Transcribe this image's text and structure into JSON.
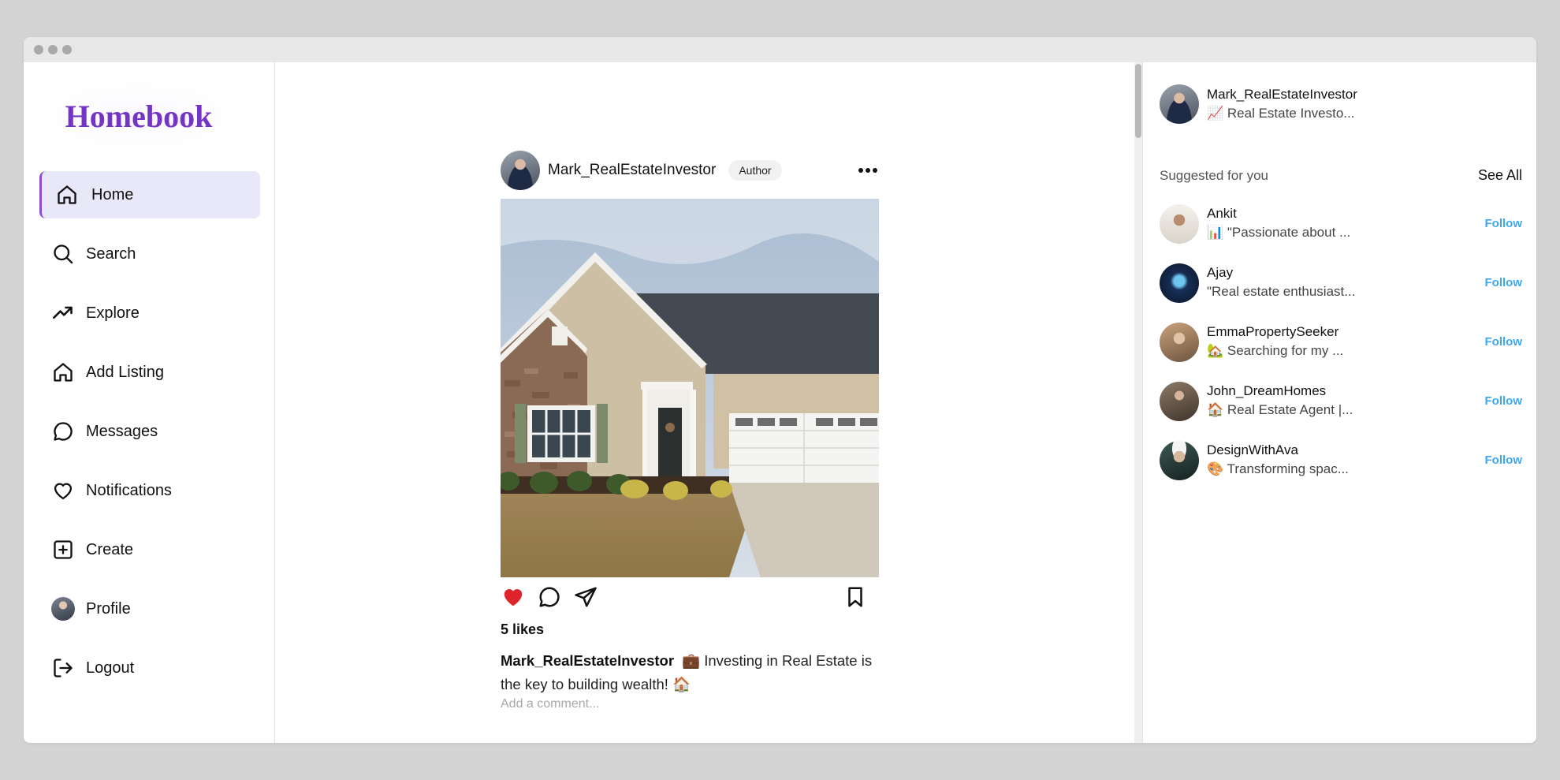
{
  "app": {
    "title": "Homebook"
  },
  "nav": [
    {
      "label": "Home",
      "icon": "home-icon",
      "active": true
    },
    {
      "label": "Search",
      "icon": "search-icon"
    },
    {
      "label": "Explore",
      "icon": "trending-icon"
    },
    {
      "label": "Add Listing",
      "icon": "house-plus-icon"
    },
    {
      "label": "Messages",
      "icon": "message-icon"
    },
    {
      "label": "Notifications",
      "icon": "heart-icon"
    },
    {
      "label": "Create",
      "icon": "plus-square-icon"
    },
    {
      "label": "Profile",
      "icon": "avatar"
    },
    {
      "label": "Logout",
      "icon": "logout-icon"
    }
  ],
  "post": {
    "username": "Mark_RealEstateInvestor",
    "badge": "Author",
    "likes": "5 likes",
    "caption_user": "Mark_RealEstateInvestor",
    "caption_text": "💼 Investing in Real Estate is the key to building wealth! 🏠",
    "comment_placeholder": "Add a comment..."
  },
  "current_user": {
    "name": "Mark_RealEstateInvestor",
    "bio": "📈 Real Estate Investo..."
  },
  "suggestions": {
    "title": "Suggested for you",
    "see_all": "See All",
    "follow_label": "Follow",
    "users": [
      {
        "name": "Ankit",
        "bio": "📊 \"Passionate about ..."
      },
      {
        "name": "Ajay",
        "bio": "\"Real estate enthusiast..."
      },
      {
        "name": "EmmaPropertySeeker",
        "bio": "🏡 Searching for my ..."
      },
      {
        "name": "John_DreamHomes",
        "bio": "🏠 Real Estate Agent |..."
      },
      {
        "name": "DesignWithAva",
        "bio": "🎨 Transforming spac..."
      }
    ]
  },
  "colors": {
    "brand": "#7434c6",
    "active_nav_bg": "#e9e8f8",
    "follow": "#3da8ef",
    "like": "#e0242b"
  }
}
